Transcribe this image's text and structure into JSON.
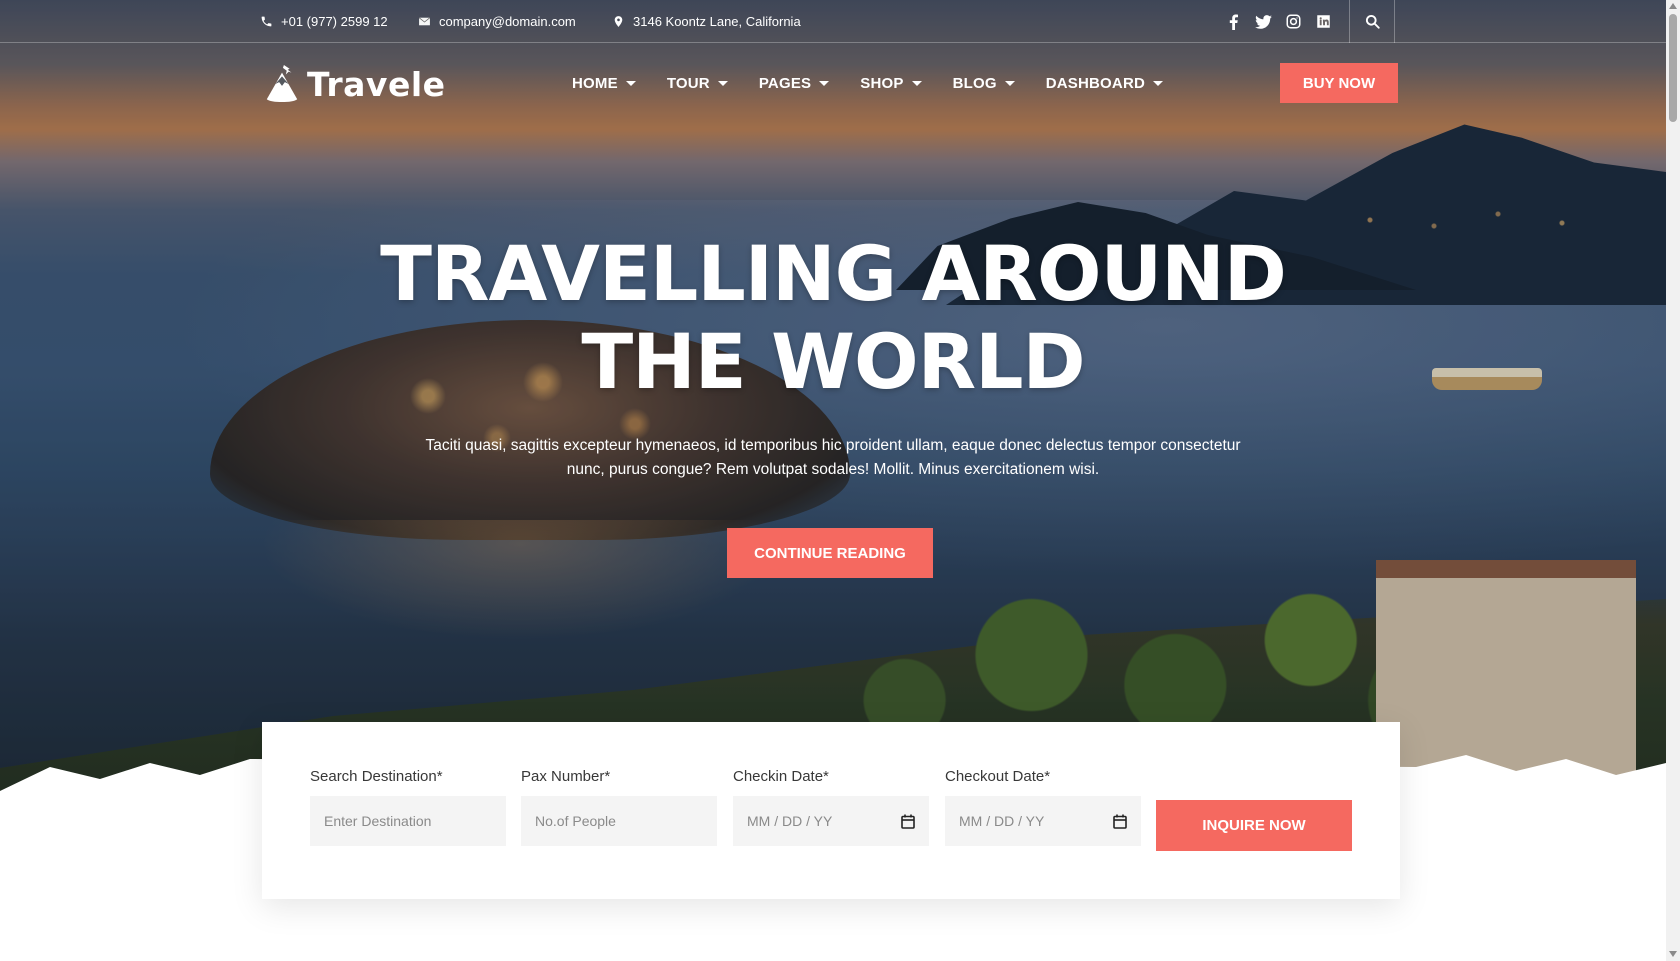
{
  "topbar": {
    "phone": "+01 (977) 2599 12",
    "email": "company@domain.com",
    "address": "3146 Koontz Lane, California",
    "social_icons": [
      "facebook-icon",
      "twitter-icon",
      "instagram-icon",
      "linkedin-icon"
    ],
    "search_icon": "search-icon"
  },
  "brand": {
    "name": "Travele",
    "accent": "#f56960"
  },
  "nav": {
    "items": [
      {
        "label": "HOME"
      },
      {
        "label": "TOUR"
      },
      {
        "label": "PAGES"
      },
      {
        "label": "SHOP"
      },
      {
        "label": "BLOG"
      },
      {
        "label": "DASHBOARD"
      }
    ],
    "buy_label": "BUY NOW"
  },
  "hero": {
    "title_line1": "TRAVELLING AROUND",
    "title_line2": "THE WORLD",
    "description_line1": "Taciti quasi, sagittis excepteur hymenaeos, id temporibus hic proident ullam, eaque donec delectus tempor consectetur",
    "description_line2": "nunc, purus congue? Rem volutpat sodales! Mollit. Minus exercitationem wisi.",
    "cta_label": "CONTINUE READING"
  },
  "inquiry": {
    "destination": {
      "label": "Search Destination*",
      "placeholder": "Enter Destination"
    },
    "pax": {
      "label": "Pax Number*",
      "placeholder": "No.of People"
    },
    "checkin": {
      "label": "Checkin Date*",
      "placeholder": "MM / DD / YY"
    },
    "checkout": {
      "label": "Checkout Date*",
      "placeholder": "MM / DD / YY"
    },
    "submit_label": "INQUIRE NOW"
  }
}
